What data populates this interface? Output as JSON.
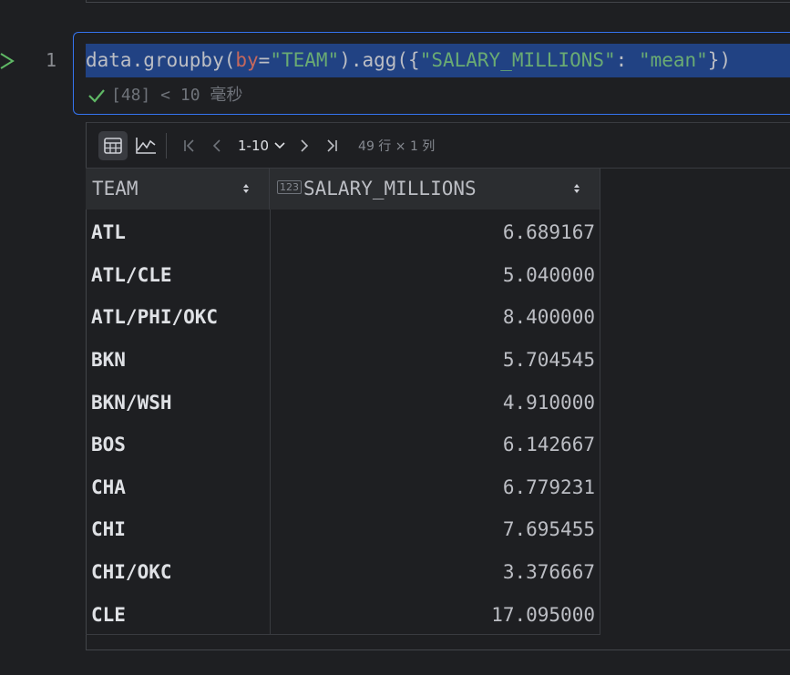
{
  "notebook": {
    "line_number": "1",
    "code": {
      "prefix": "data.groupby(",
      "param_name": "by",
      "equals": "=",
      "group_col": "\"TEAM\"",
      "middle": ").agg({",
      "agg_col": "\"SALARY_MILLIONS\"",
      "colon": ": ",
      "agg_func": "\"mean\"",
      "suffix": "})"
    },
    "exec_status": "[48] < 10 毫秒"
  },
  "toolbar": {
    "page_range": "1-10",
    "row_col_info": "49 行 × 1 列"
  },
  "table": {
    "columns": [
      {
        "name": "TEAM"
      },
      {
        "name": "SALARY_MILLIONS",
        "type_badge": "123"
      }
    ],
    "rows": [
      {
        "team": "ATL",
        "salary": "6.689167"
      },
      {
        "team": "ATL/CLE",
        "salary": "5.040000"
      },
      {
        "team": "ATL/PHI/OKC",
        "salary": "8.400000"
      },
      {
        "team": "BKN",
        "salary": "5.704545"
      },
      {
        "team": "BKN/WSH",
        "salary": "4.910000"
      },
      {
        "team": "BOS",
        "salary": "6.142667"
      },
      {
        "team": "CHA",
        "salary": "6.779231"
      },
      {
        "team": "CHI",
        "salary": "7.695455"
      },
      {
        "team": "CHI/OKC",
        "salary": "3.376667"
      },
      {
        "team": "CLE",
        "salary": "17.095000"
      }
    ]
  },
  "icons": {
    "run": "run-triangle-icon",
    "success": "check-icon",
    "table_view": "table-view-icon",
    "chart_view": "chart-view-icon",
    "first": "first-page-icon",
    "prev": "prev-page-icon",
    "next": "next-page-icon",
    "last": "last-page-icon",
    "sort": "sort-icon"
  },
  "colors": {
    "background": "#1e1f22",
    "selection": "#214283",
    "string": "#6aab73",
    "param": "#c5685d",
    "success": "#5fb865",
    "focus_border": "#3574f0"
  }
}
